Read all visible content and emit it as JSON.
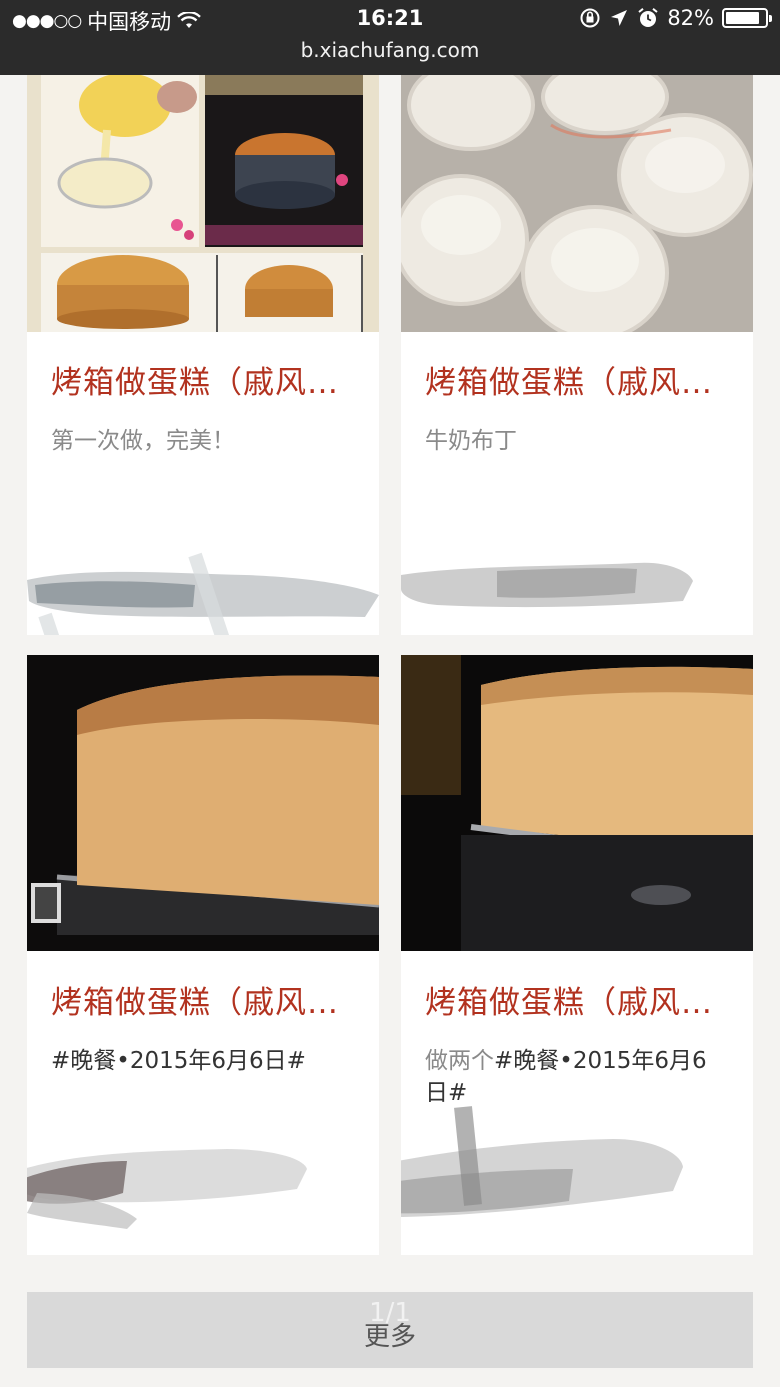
{
  "status_bar": {
    "signal": "●●●○○",
    "carrier": "中国移动",
    "wifi_icon": "wifi-icon",
    "time": "16:21",
    "battery_percent": "82%",
    "url": "b.xiachufang.com"
  },
  "cards": [
    {
      "title": "烤箱做蛋糕（戚风…",
      "desc": "第一次做，完美！",
      "desc_prefix": "",
      "image": "cake-making-collage"
    },
    {
      "title": "烤箱做蛋糕（戚风…",
      "desc": "牛奶布丁",
      "desc_prefix": "",
      "image": "milk-pudding-cups"
    },
    {
      "title": "烤箱做蛋糕（戚风…",
      "desc": "#晚餐•2015年6月6日#",
      "desc_prefix": "",
      "image": "chiffon-cake-closeup"
    },
    {
      "title": "烤箱做蛋糕（戚风…",
      "desc": "#晚餐•2015年6月6日#",
      "desc_prefix": "做两个",
      "image": "chiffon-cake-closeup-2"
    }
  ],
  "pager": {
    "page": "1/1",
    "more_label": "更多"
  }
}
